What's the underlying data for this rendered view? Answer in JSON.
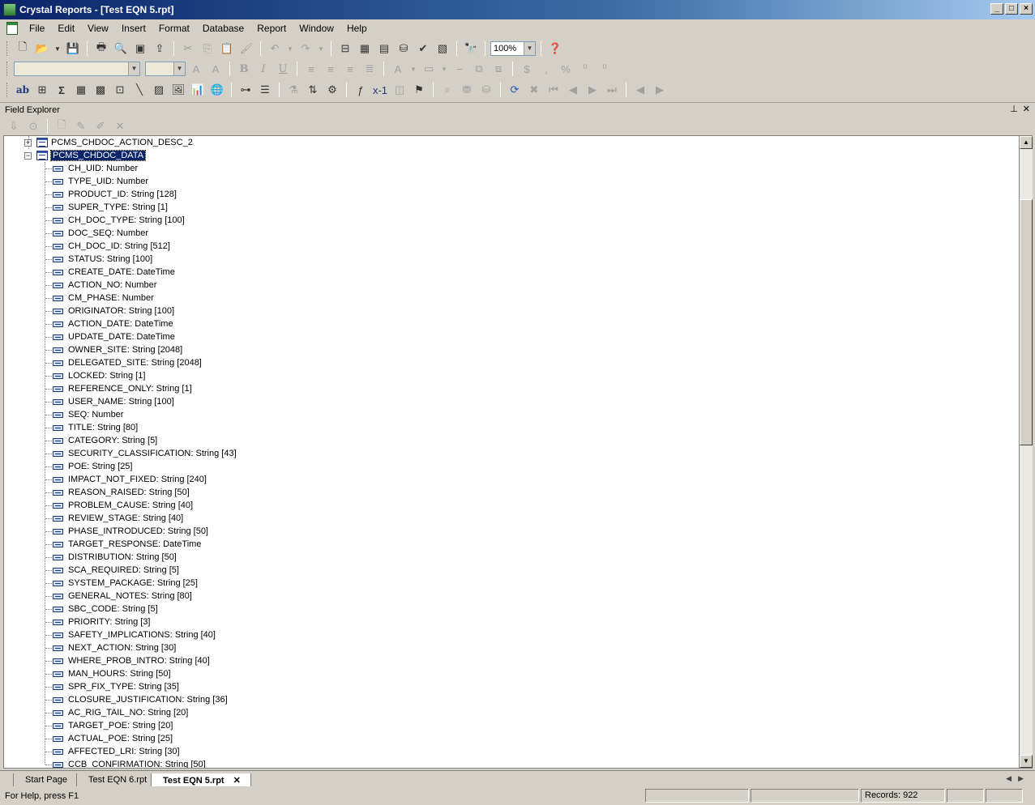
{
  "window": {
    "title": "Crystal Reports - [Test EQN 5.rpt]"
  },
  "menu": [
    "File",
    "Edit",
    "View",
    "Insert",
    "Format",
    "Database",
    "Report",
    "Window",
    "Help"
  ],
  "toolbar": {
    "zoom": "100%"
  },
  "panel": {
    "title": "Field Explorer"
  },
  "tree": {
    "collapsed_table": "PCMS_CHDOC_ACTION_DESC_2",
    "expanded_table": "PCMS_CHDOC_DATA",
    "fields": [
      "CH_UID: Number",
      "TYPE_UID: Number",
      "PRODUCT_ID: String [128]",
      "SUPER_TYPE: String [1]",
      "CH_DOC_TYPE: String [100]",
      "DOC_SEQ: Number",
      "CH_DOC_ID: String [512]",
      "STATUS: String [100]",
      "CREATE_DATE: DateTime",
      "ACTION_NO: Number",
      "CM_PHASE: Number",
      "ORIGINATOR: String [100]",
      "ACTION_DATE: DateTime",
      "UPDATE_DATE: DateTime",
      "OWNER_SITE: String [2048]",
      "DELEGATED_SITE: String [2048]",
      "LOCKED: String [1]",
      "REFERENCE_ONLY: String [1]",
      "USER_NAME: String [100]",
      "SEQ: Number",
      "TITLE: String [80]",
      "CATEGORY: String [5]",
      "SECURITY_CLASSIFICATION: String [43]",
      "POE: String [25]",
      "IMPACT_NOT_FIXED: String [240]",
      "REASON_RAISED: String [50]",
      "PROBLEM_CAUSE: String [40]",
      "REVIEW_STAGE: String [40]",
      "PHASE_INTRODUCED: String [50]",
      "TARGET_RESPONSE: DateTime",
      "DISTRIBUTION: String [50]",
      "SCA_REQUIRED: String [5]",
      "SYSTEM_PACKAGE: String [25]",
      "GENERAL_NOTES: String [80]",
      "SBC_CODE: String [5]",
      "PRIORITY: String [3]",
      "SAFETY_IMPLICATIONS: String [40]",
      "NEXT_ACTION: String [30]",
      "WHERE_PROB_INTRO: String [40]",
      "MAN_HOURS: String [50]",
      "SPR_FIX_TYPE: String [35]",
      "CLOSURE_JUSTIFICATION: String [36]",
      "AC_RIG_TAIL_NO: String [20]",
      "TARGET_POE: String [20]",
      "ACTUAL_POE: String [25]",
      "AFFECTED_LRI: String [30]",
      "CCB_CONFIRMATION: String [50]"
    ]
  },
  "tabs": [
    {
      "label": "Start Page",
      "active": false
    },
    {
      "label": "Test EQN 6.rpt",
      "active": false
    },
    {
      "label": "Test EQN 5.rpt",
      "active": true
    }
  ],
  "status": {
    "help_text": "For Help, press F1",
    "records": "Records:  922"
  }
}
